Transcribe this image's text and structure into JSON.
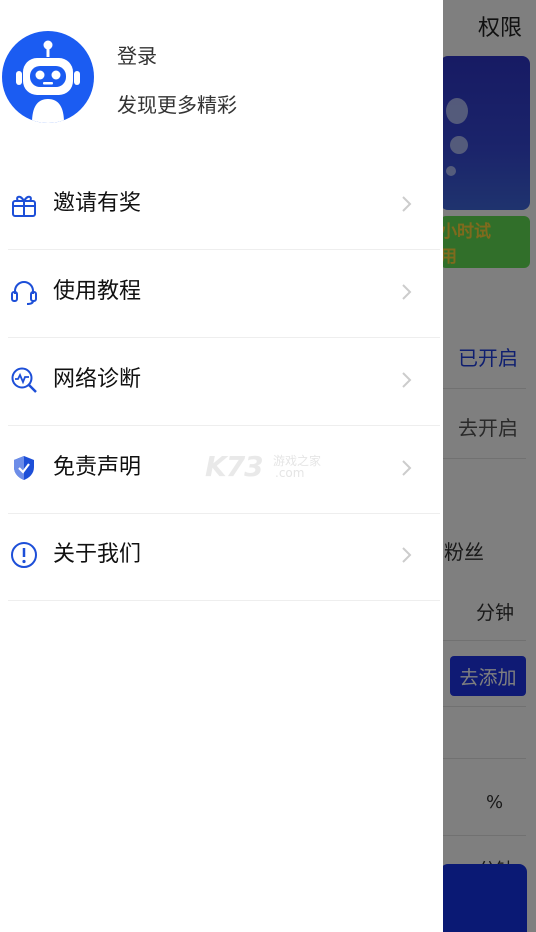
{
  "background": {
    "title": "权限",
    "trial_text": "小时试用",
    "status_enabled": "已开启",
    "status_action": "去开启",
    "fans_label": "粉丝",
    "minutes_label": "分钟",
    "add_button": "去添加",
    "percent_label": "%",
    "minutes_label_2": "分钟"
  },
  "drawer": {
    "login": "登录",
    "subtitle": "发现更多精彩",
    "menu": [
      {
        "label": "邀请有奖",
        "icon": "gift-icon"
      },
      {
        "label": "使用教程",
        "icon": "headset-icon"
      },
      {
        "label": "网络诊断",
        "icon": "network-diagnose-icon"
      },
      {
        "label": "免责声明",
        "icon": "shield-check-icon"
      },
      {
        "label": "关于我们",
        "icon": "info-circle-icon"
      }
    ]
  },
  "watermark": {
    "main": "K73",
    "top": "游戏之家",
    "bottom": ".com"
  },
  "colors": {
    "accent": "#1b5cf2",
    "icon_blue": "#1d4fd8",
    "add_button": "#1e35e8",
    "trial": "#63df55"
  }
}
